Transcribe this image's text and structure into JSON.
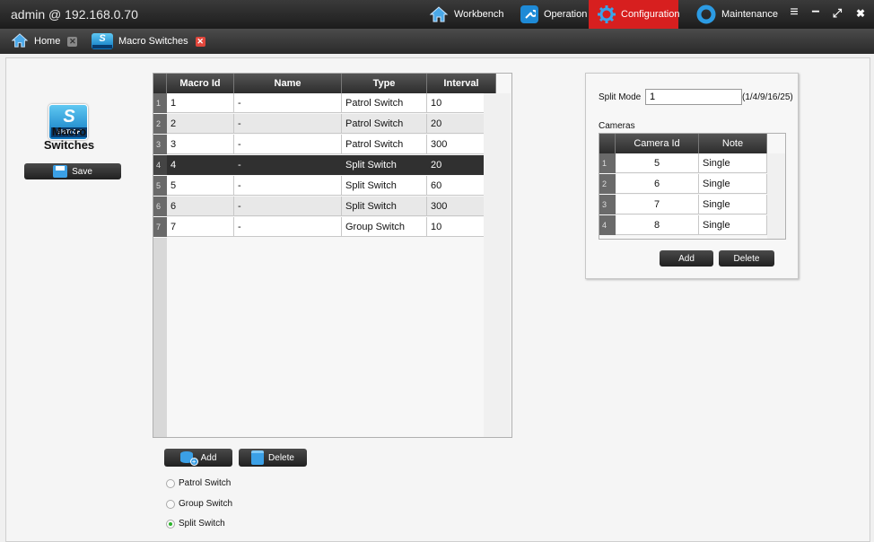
{
  "window": {
    "title": "admin @ 192.168.0.70",
    "nav": [
      {
        "label": "Workbench",
        "icon": "home-icon"
      },
      {
        "label": "Operation",
        "icon": "wrench-icon"
      },
      {
        "label": "Configuration",
        "icon": "gear-icon",
        "active": true
      },
      {
        "label": "Maintenance",
        "icon": "circle-icon"
      }
    ],
    "controls": {
      "menu": "≡",
      "minimize": "−",
      "maximize": "⤢",
      "close": "✖"
    }
  },
  "tabs": [
    {
      "label": "Home",
      "icon": "home-icon"
    },
    {
      "label": "Macro Switches",
      "icon": "switch-icon"
    }
  ],
  "left": {
    "logo_text": "SWITCH",
    "title": "Macro Switches",
    "save_label": "Save"
  },
  "macro_table": {
    "columns": [
      "Macro Id",
      "Name",
      "Type",
      "Interval"
    ],
    "rows": [
      {
        "num": "1",
        "id": "1",
        "name": "-",
        "type": "Patrol Switch",
        "interval": "10"
      },
      {
        "num": "2",
        "id": "2",
        "name": "-",
        "type": "Patrol Switch",
        "interval": "20"
      },
      {
        "num": "3",
        "id": "3",
        "name": "-",
        "type": "Patrol Switch",
        "interval": "300"
      },
      {
        "num": "4",
        "id": "4",
        "name": "-",
        "type": "Split Switch",
        "interval": "20"
      },
      {
        "num": "5",
        "id": "5",
        "name": "-",
        "type": "Split Switch",
        "interval": "60"
      },
      {
        "num": "6",
        "id": "6",
        "name": "-",
        "type": "Split Switch",
        "interval": "300"
      },
      {
        "num": "7",
        "id": "7",
        "name": "-",
        "type": "Group Switch",
        "interval": "10"
      }
    ],
    "selected_row": 4
  },
  "actions": {
    "add": "Add",
    "delete": "Delete"
  },
  "radios": [
    {
      "label": "Patrol Switch",
      "checked": false
    },
    {
      "label": "Group Switch",
      "checked": false
    },
    {
      "label": "Split Switch",
      "checked": true
    }
  ],
  "right": {
    "split_mode_label": "Split Mode",
    "split_mode_value": "1",
    "split_mode_hint": "(1/4/9/16/25)",
    "cameras_label": "Cameras",
    "camera_columns": [
      "Camera Id",
      "Note"
    ],
    "cameras": [
      {
        "num": "1",
        "id": "5",
        "note": "Single"
      },
      {
        "num": "2",
        "id": "6",
        "note": "Single"
      },
      {
        "num": "3",
        "id": "7",
        "note": "Single"
      },
      {
        "num": "4",
        "id": "8",
        "note": "Single"
      }
    ],
    "add": "Add",
    "delete": "Delete"
  },
  "colors": {
    "active_nav": "#d71f1f",
    "accent_blue": "#1e8ad6",
    "radio_checked": "#2bb32b"
  }
}
